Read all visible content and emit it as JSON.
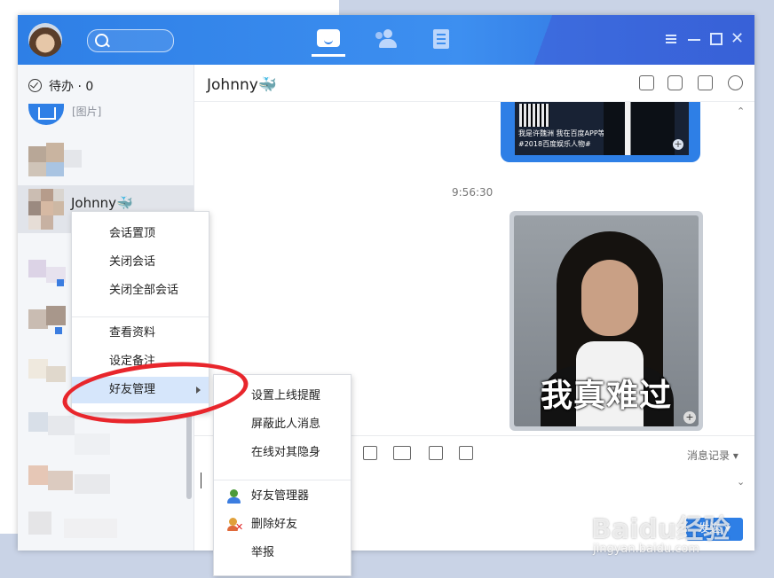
{
  "sidebar": {
    "todo_label": "待办 · 0",
    "preview_text": "[图片]",
    "selected_contact": "Johnny🐳"
  },
  "chat": {
    "title": "Johnny🐳",
    "shared_card_caption": "我是许魏洲 我在百度APP等你 #2018百度娱乐人物#",
    "timestamp": "9:56:30",
    "meme_text": "我真难过",
    "history_label": "消息记录",
    "send_label": "发送"
  },
  "context_menu": {
    "items": [
      "会话置顶",
      "关闭会话",
      "关闭全部会话",
      "查看资料",
      "设定备注",
      "好友管理"
    ]
  },
  "submenu": {
    "items": [
      "设置上线提醒",
      "屏蔽此人消息",
      "在线对其隐身",
      "好友管理器",
      "删除好友",
      "举报"
    ]
  },
  "watermark": {
    "brand": "Baidu经验",
    "url": "jingyan.baidu.com"
  },
  "colors": {
    "accent": "#2e7fe6",
    "highlight": "#d6e6fb",
    "annotation_ring": "#e8262c"
  }
}
